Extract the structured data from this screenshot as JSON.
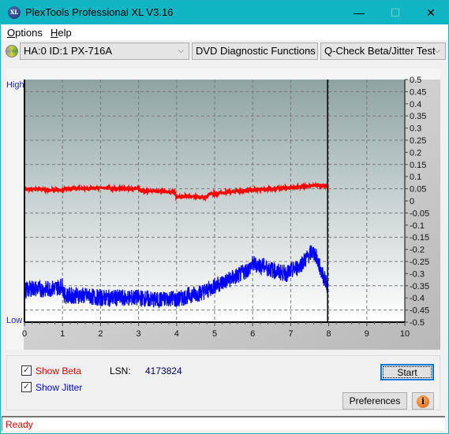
{
  "window": {
    "title": "PlexTools Professional XL V3.16",
    "logo_text": "XL",
    "minimize_glyph": "—",
    "maximize_glyph": "☐",
    "close_glyph": "✕"
  },
  "menu": {
    "items": [
      {
        "label": "Options",
        "accel": "O"
      },
      {
        "label": "Help",
        "accel": "H"
      }
    ]
  },
  "toolbar": {
    "drive_select": "HA:0 ID:1  PX-716A",
    "function_select": "DVD Diagnostic Functions",
    "test_select": "Q-Check Beta/Jitter Test",
    "dropdown_glyph": "⌵"
  },
  "chart_data": {
    "type": "line",
    "title": "",
    "xlabel": "",
    "ylabel": "",
    "left_axis_labels": {
      "top": "High",
      "bottom": "Low"
    },
    "xlim": [
      0,
      10
    ],
    "ylim": [
      -0.5,
      0.5
    ],
    "x_ticks": [
      0,
      1,
      2,
      3,
      4,
      5,
      6,
      7,
      8,
      9,
      10
    ],
    "y_ticks": [
      0.5,
      0.45,
      0.4,
      0.35,
      0.3,
      0.25,
      0.2,
      0.15,
      0.1,
      0.05,
      0,
      -0.05,
      -0.1,
      -0.15,
      -0.2,
      -0.25,
      -0.3,
      -0.35,
      -0.4,
      -0.45,
      -0.5
    ],
    "grid": true,
    "cursor_x": 7.97,
    "series": [
      {
        "name": "Beta",
        "color": "#ff0000",
        "x": [
          0,
          0.3,
          0.6,
          0.9,
          1.0,
          1.05,
          1.5,
          2.0,
          2.5,
          3.0,
          3.05,
          3.5,
          3.9,
          3.95,
          4.0,
          4.3,
          4.6,
          4.8,
          4.85,
          5.2,
          5.6,
          6.0,
          6.5,
          7.0,
          7.4,
          7.7,
          7.97
        ],
        "values": [
          0.048,
          0.05,
          0.046,
          0.044,
          0.04,
          0.052,
          0.05,
          0.055,
          0.05,
          0.05,
          0.042,
          0.04,
          0.036,
          0.035,
          0.015,
          0.02,
          0.015,
          0.015,
          0.028,
          0.033,
          0.04,
          0.046,
          0.05,
          0.055,
          0.06,
          0.065,
          0.06
        ]
      },
      {
        "name": "Jitter",
        "color": "#0000ff",
        "x": [
          0,
          0.2,
          0.5,
          0.8,
          1.0,
          1.05,
          1.5,
          2.0,
          2.5,
          3.0,
          3.5,
          3.9,
          4.0,
          4.3,
          4.6,
          4.8,
          5.0,
          5.3,
          5.6,
          5.9,
          6.0,
          6.3,
          6.6,
          6.9,
          7.0,
          7.2,
          7.4,
          7.55,
          7.65,
          7.8,
          7.97
        ],
        "values": [
          -0.37,
          -0.36,
          -0.365,
          -0.36,
          -0.35,
          -0.39,
          -0.39,
          -0.4,
          -0.4,
          -0.4,
          -0.41,
          -0.4,
          -0.41,
          -0.39,
          -0.38,
          -0.37,
          -0.35,
          -0.33,
          -0.31,
          -0.28,
          -0.26,
          -0.27,
          -0.29,
          -0.3,
          -0.29,
          -0.27,
          -0.24,
          -0.21,
          -0.22,
          -0.29,
          -0.35
        ]
      }
    ]
  },
  "controls": {
    "show_beta": {
      "label": "Show Beta",
      "checked": true,
      "color": "#e00000"
    },
    "show_jitter": {
      "label": "Show Jitter",
      "checked": true,
      "color": "#0000e0"
    },
    "lsn_label": "LSN:",
    "lsn_value": "4173824",
    "start_label": "Start",
    "preferences_label": "Preferences",
    "info_glyph": "i",
    "check_glyph": "✓"
  },
  "status": {
    "text": "Ready"
  }
}
